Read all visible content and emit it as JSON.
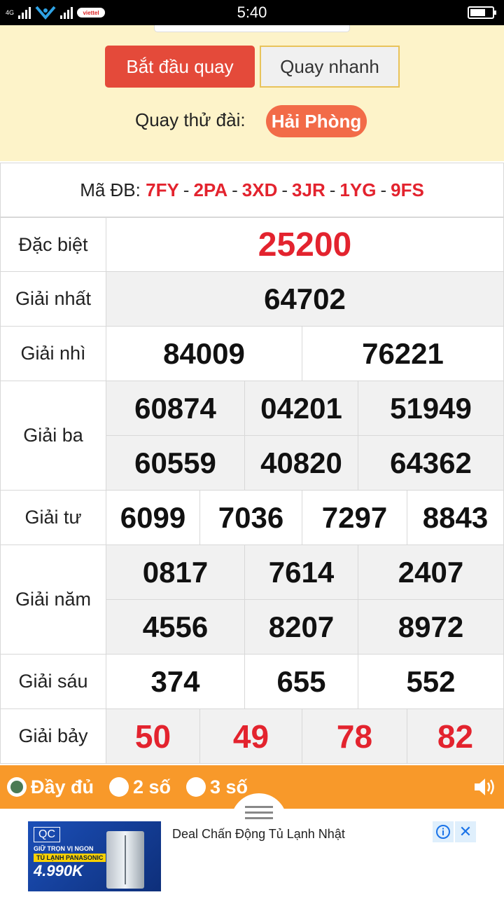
{
  "status": {
    "time": "5:40",
    "network": "4G",
    "carrier": "viettel"
  },
  "controls": {
    "start_label": "Bắt đầu quay",
    "quick_label": "Quay nhanh",
    "station_prefix": "Quay thử đài:",
    "station": "Hải Phòng"
  },
  "madb": {
    "label": "Mã ĐB:",
    "codes": [
      "7FY",
      "2PA",
      "3XD",
      "3JR",
      "1YG",
      "9FS"
    ]
  },
  "prizes": {
    "dac_biet": {
      "label": "Đặc biệt",
      "numbers": [
        "25200"
      ]
    },
    "nhat": {
      "label": "Giải nhất",
      "numbers": [
        "64702"
      ]
    },
    "nhi": {
      "label": "Giải nhì",
      "numbers": [
        "84009",
        "76221"
      ]
    },
    "ba": {
      "label": "Giải ba",
      "numbers": [
        "60874",
        "04201",
        "51949",
        "60559",
        "40820",
        "64362"
      ]
    },
    "tu": {
      "label": "Giải tư",
      "numbers": [
        "6099",
        "7036",
        "7297",
        "8843"
      ]
    },
    "nam": {
      "label": "Giải năm",
      "numbers": [
        "0817",
        "7614",
        "2407",
        "4556",
        "8207",
        "8972"
      ]
    },
    "sau": {
      "label": "Giải sáu",
      "numbers": [
        "374",
        "655",
        "552"
      ]
    },
    "bay": {
      "label": "Giải bảy",
      "numbers": [
        "50",
        "49",
        "78",
        "82"
      ]
    }
  },
  "options": {
    "full": "Đầy đủ",
    "two": "2 số",
    "three": "3 số",
    "selected": "full"
  },
  "ad": {
    "badge": "QC",
    "title": "Deal Chấn Động Tủ Lạnh Nhật",
    "img_line1": "GIỮ TRỌN VỊ NGON",
    "img_line2": "TỦ LẠNH PANASONIC",
    "img_price": "4.990K"
  },
  "colors": {
    "accent_red": "#e3232e",
    "orange_bar": "#f8992a",
    "panel_bg": "#fdf3c9"
  }
}
